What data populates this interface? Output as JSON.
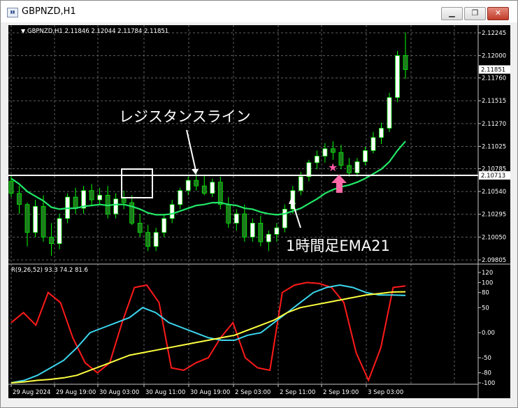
{
  "window": {
    "title": "GBPNZD,H1",
    "icon_name": "chart-window-icon",
    "buttons": {
      "minimize": "minimize-icon",
      "restore": "restore-icon",
      "close": "close-icon"
    }
  },
  "chart": {
    "symbol_line": "GBPNZD,H1  2.11846 2.12044 2.11784 2.11851",
    "price_ticks": [
      "2.12245",
      "2.12000",
      "2.11760",
      "2.11515",
      "2.11270",
      "2.11025",
      "2.10785",
      "2.10540",
      "2.10295",
      "2.10050",
      "2.09805"
    ],
    "current_price": "2.11851",
    "line_price": "2.10713",
    "time_labels": [
      "29 Aug 2024",
      "29 Aug 19:00",
      "30 Aug 03:00",
      "30 Aug 11:00",
      "30 Aug 19:00",
      "2 Sep 03:00",
      "2 Sep 11:00",
      "2 Sep 19:00",
      "3 Sep 03:00"
    ],
    "annotation_resistance": "レジスタンスライン",
    "annotation_ema": "1時間足EMA21",
    "osc_label": "R(9,26,52) 93.3 74.2 81.6",
    "osc_ticks": [
      "120",
      "100",
      "80",
      "50",
      "0.00",
      "-50",
      "-80",
      "-100"
    ],
    "colors": {
      "background": "#000000",
      "bull_candle": "#ffffff",
      "bear_candle": "#1e7a1e",
      "wick": "#00ff00",
      "ema": "#22e868",
      "resistance": "#ffffff",
      "marker_star": "#ff5aa8",
      "marker_arrow": "#ff6aa8",
      "osc_red": "#ff1a1a",
      "osc_cyan": "#3cd6ee",
      "osc_yellow": "#ffff40",
      "grid": "#606060"
    }
  },
  "chart_data": [
    {
      "type": "candlestick",
      "title": "GBPNZD,H1",
      "ylim": [
        2.09805,
        2.12245
      ],
      "ohlc_sampled": [
        [
          2.1065,
          2.1072,
          2.1048,
          2.1052
        ],
        [
          2.1052,
          2.106,
          2.103,
          2.104
        ],
        [
          2.104,
          2.1042,
          2.0995,
          2.101
        ],
        [
          2.101,
          2.1045,
          2.1005,
          2.1038
        ],
        [
          2.1038,
          2.105,
          2.1,
          2.1005
        ],
        [
          2.1005,
          2.102,
          2.0985,
          2.0998
        ],
        [
          2.0998,
          2.103,
          2.0992,
          2.1025
        ],
        [
          2.1025,
          2.1052,
          2.102,
          2.1048
        ],
        [
          2.1048,
          2.1058,
          2.103,
          2.1036
        ],
        [
          2.1036,
          2.106,
          2.103,
          2.1055
        ],
        [
          2.1055,
          2.1062,
          2.1038,
          2.1045
        ],
        [
          2.1045,
          2.1058,
          2.104,
          2.105
        ],
        [
          2.105,
          2.106,
          2.1025,
          2.103
        ],
        [
          2.103,
          2.1052,
          2.1025,
          2.1046
        ],
        [
          2.1046,
          2.1055,
          2.1035,
          2.1042
        ],
        [
          2.1042,
          2.105,
          2.1018,
          2.102
        ],
        [
          2.102,
          2.103,
          2.1005,
          2.101
        ],
        [
          2.101,
          2.1018,
          2.099,
          2.0995
        ],
        [
          2.0995,
          2.1015,
          2.099,
          2.101
        ],
        [
          2.101,
          2.103,
          2.1005,
          2.1025
        ],
        [
          2.1025,
          2.1045,
          2.102,
          2.104
        ],
        [
          2.104,
          2.1058,
          2.1035,
          2.1055
        ],
        [
          2.1055,
          2.107,
          2.105,
          2.1066
        ],
        [
          2.1066,
          2.1075,
          2.1055,
          2.106
        ],
        [
          2.106,
          2.1072,
          2.105,
          2.1052
        ],
        [
          2.1052,
          2.1068,
          2.1048,
          2.1064
        ],
        [
          2.1064,
          2.107,
          2.1035,
          2.104
        ],
        [
          2.104,
          2.1048,
          2.1015,
          2.102
        ],
        [
          2.102,
          2.1035,
          2.1012,
          2.103
        ],
        [
          2.103,
          2.104,
          2.1,
          2.1005
        ],
        [
          2.1005,
          2.1025,
          2.1,
          2.102
        ],
        [
          2.102,
          2.1028,
          2.0995,
          2.1
        ],
        [
          2.1,
          2.1012,
          2.099,
          2.1008
        ],
        [
          2.1008,
          2.102,
          2.1,
          2.1015
        ],
        [
          2.1015,
          2.104,
          2.101,
          2.1035
        ],
        [
          2.1035,
          2.106,
          2.103,
          2.1055
        ],
        [
          2.1055,
          2.1075,
          2.105,
          2.107
        ],
        [
          2.107,
          2.1088,
          2.1065,
          2.1085
        ],
        [
          2.1085,
          2.1098,
          2.1078,
          2.1092
        ],
        [
          2.1092,
          2.1106,
          2.1085,
          2.11
        ],
        [
          2.11,
          2.1108,
          2.1088,
          2.1096
        ],
        [
          2.1096,
          2.1104,
          2.1078,
          2.1082
        ],
        [
          2.1082,
          2.109,
          2.107,
          2.1074
        ],
        [
          2.1074,
          2.109,
          2.107,
          2.1086
        ],
        [
          2.1086,
          2.1102,
          2.1082,
          2.1098
        ],
        [
          2.1098,
          2.1118,
          2.1095,
          2.1112
        ],
        [
          2.1112,
          2.1128,
          2.1105,
          2.1122
        ],
        [
          2.1122,
          2.116,
          2.1118,
          2.1155
        ],
        [
          2.1155,
          2.1205,
          2.115,
          2.12
        ],
        [
          2.12,
          2.1225,
          2.1175,
          2.1185
        ]
      ],
      "series": [
        {
          "name": "",
          "values": [
            2.1068,
            2.1062,
            2.1054,
            2.1049,
            2.1044,
            2.1037,
            2.1035,
            2.1036,
            2.1036,
            2.1038,
            2.1039,
            2.104,
            2.1039,
            2.104,
            2.104,
            2.1038,
            2.1035,
            2.1031,
            2.1029,
            2.1029,
            2.103,
            2.1033,
            2.1036,
            2.1039,
            2.104,
            2.1042,
            2.1042,
            2.104,
            2.1039,
            2.1036,
            2.1035,
            2.1032,
            2.103,
            2.1029,
            2.103,
            2.1033,
            2.1036,
            2.1041,
            2.1046,
            2.1052,
            2.1056,
            2.1059,
            2.1061,
            2.1064,
            2.1068,
            2.1073,
            2.1078,
            2.1086,
            2.1098,
            2.1108
          ]
        }
      ],
      "annotations": [
        "レジスタンスライン",
        "1時間足EMA21"
      ]
    },
    {
      "type": "line",
      "title": "R(9,26,52) 93.3 74.2 81.6",
      "ylim": [
        -100,
        120
      ],
      "series": [
        {
          "name": "",
          "values": [
            20,
            40,
            15,
            80,
            60,
            -10,
            -60,
            -80,
            -60,
            20,
            90,
            95,
            60,
            -70,
            -75,
            -60,
            -50,
            -10,
            20,
            -50,
            -70,
            -75,
            80,
            95,
            100,
            98,
            90,
            60,
            -40,
            -95,
            -30,
            90,
            93.3
          ]
        },
        {
          "name": "",
          "values": [
            -100,
            -95,
            -85,
            -70,
            -55,
            -30,
            0,
            10,
            20,
            30,
            50,
            40,
            20,
            10,
            0,
            -10,
            -15,
            -15,
            -5,
            0,
            20,
            40,
            60,
            80,
            90,
            95,
            90,
            80,
            75,
            75,
            74.2
          ]
        },
        {
          "name": "",
          "values": [
            -100,
            -98,
            -95,
            -93,
            -90,
            -85,
            -75,
            -65,
            -55,
            -45,
            -40,
            -35,
            -30,
            -25,
            -20,
            -15,
            -10,
            -5,
            5,
            15,
            25,
            40,
            50,
            55,
            60,
            65,
            70,
            75,
            78,
            81,
            81.6
          ]
        }
      ]
    }
  ]
}
